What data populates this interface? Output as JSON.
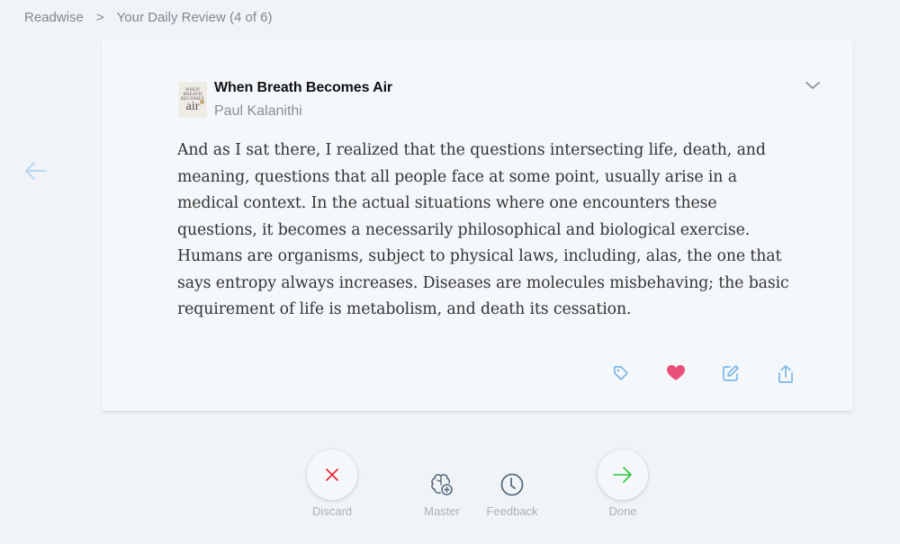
{
  "breadcrumb": {
    "root": "Readwise",
    "separator": ">",
    "current": "Your Daily Review (4 of 6)"
  },
  "nav": {
    "back_icon": "arrow-left-icon"
  },
  "highlight": {
    "book_title": "When Breath Becomes Air",
    "author": "Paul Kalanithi",
    "cover_text_top": "WHEN BREATH BECOMES",
    "cover_text_main": "air",
    "text": "And as I sat there, I realized that the questions intersecting life, death, and meaning, questions that all people face at some point, usually arise in a medical context. In the actual situations where one encounters these questions, it becomes a necessarily philosophical and biological exercise. Humans are organisms, subject to physical laws, including, alas, the one that says entropy always increases. Diseases are molecules misbehaving; the basic requirement of life is metabolism, and death its cessation.",
    "favorited": true
  },
  "card_actions": [
    {
      "name": "tag",
      "icon": "tag-icon"
    },
    {
      "name": "favorite",
      "icon": "heart-icon"
    },
    {
      "name": "edit",
      "icon": "edit-icon"
    },
    {
      "name": "share",
      "icon": "share-icon"
    }
  ],
  "review_controls": {
    "discard": "Discard",
    "master": "Master",
    "feedback": "Feedback",
    "done": "Done"
  },
  "colors": {
    "accent_blue": "#7cb8e8",
    "heart": "#e8507a",
    "discard_red": "#e8242c",
    "done_green": "#2fc23a",
    "icon_slate": "#5a6d80"
  }
}
